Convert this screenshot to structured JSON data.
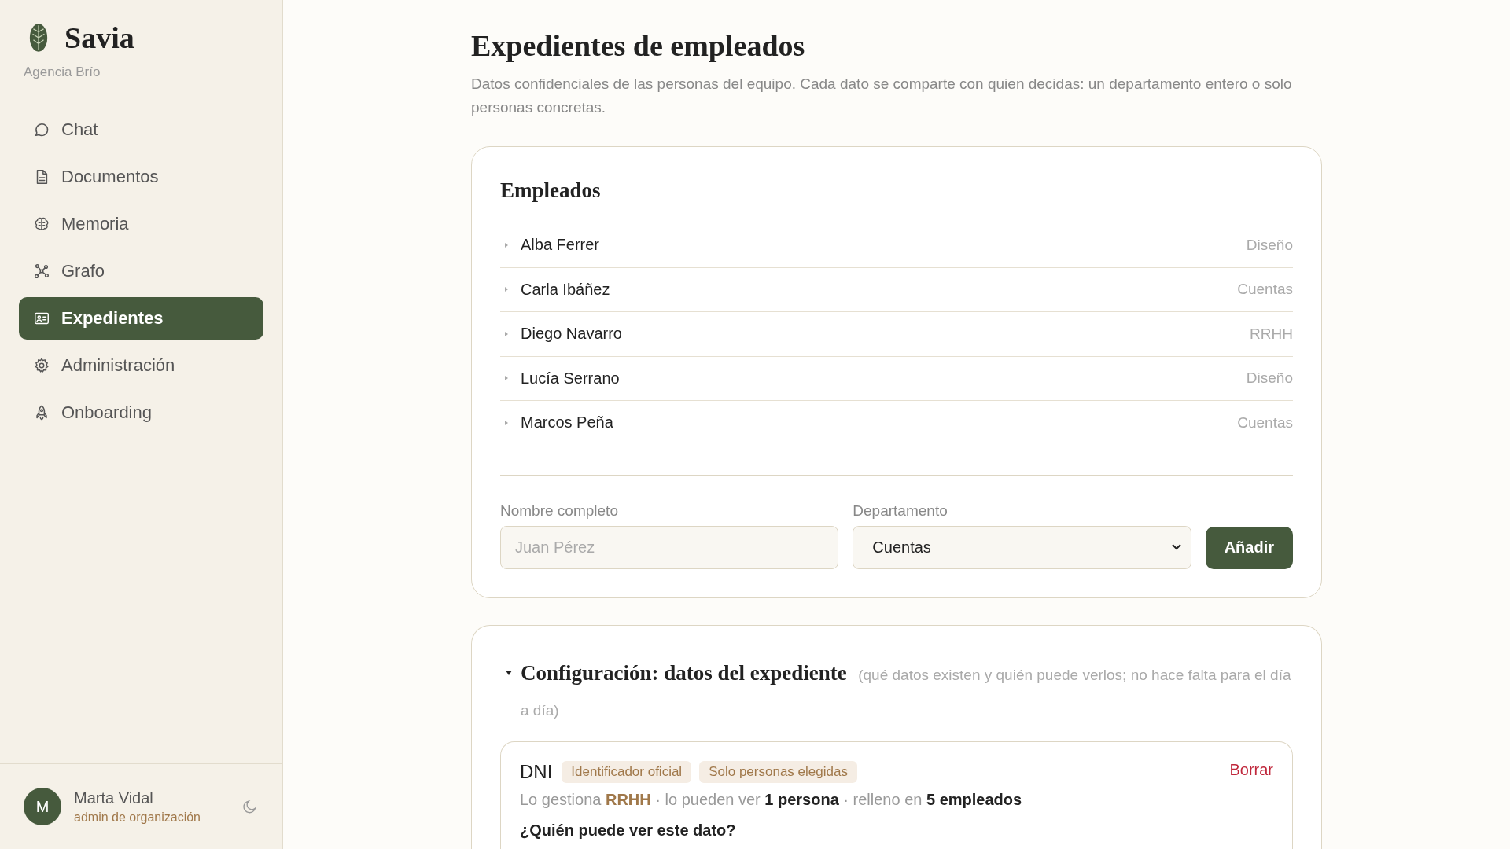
{
  "sidebar": {
    "brand": "Savia",
    "organization": "Agencia Brío",
    "nav": [
      {
        "label": "Chat",
        "kind": "chat",
        "selected": false
      },
      {
        "label": "Documentos",
        "kind": "document",
        "selected": false
      },
      {
        "label": "Memoria",
        "kind": "brain",
        "selected": false
      },
      {
        "label": "Grafo",
        "kind": "graph",
        "selected": false
      },
      {
        "label": "Expedientes",
        "kind": "card",
        "selected": true
      },
      {
        "label": "Administración",
        "kind": "gear",
        "selected": false
      },
      {
        "label": "Onboarding",
        "kind": "rocket",
        "selected": false
      }
    ],
    "user": {
      "initial": "M",
      "name": "Marta Vidal",
      "role": "admin de organización"
    }
  },
  "page": {
    "title": "Expedientes de empleados",
    "subtitle": "Datos confidenciales de las personas del equipo. Cada dato se comparte con quien decidas: un departamento entero o solo personas concretas."
  },
  "employees_card": {
    "title": "Empleados",
    "employees": [
      {
        "name": "Alba Ferrer",
        "department": "Diseño",
        "expanded": false
      },
      {
        "name": "Carla Ibáñez",
        "department": "Cuentas",
        "expanded": false
      },
      {
        "name": "Diego Navarro",
        "department": "RRHH",
        "expanded": false
      },
      {
        "name": "Lucía Serrano",
        "department": "Diseño",
        "expanded": false
      },
      {
        "name": "Marcos Peña",
        "department": "Cuentas",
        "expanded": false
      }
    ],
    "form": {
      "fields": [
        {
          "kind": "text",
          "label": "Nombre completo",
          "placeholder": "Juan Pérez"
        },
        {
          "kind": "select",
          "label": "Departamento",
          "value": "Cuentas"
        }
      ],
      "submit": "Añadir"
    }
  },
  "config": {
    "title": "Configuración: datos del expediente",
    "hint": "(qué datos existen y quién puede verlos; no hace falta para el día a día)",
    "expanded": true,
    "fields": [
      {
        "name": "DNI",
        "tags": [
          "Identificador oficial",
          "Solo personas elegidas"
        ],
        "delete": "Borrar",
        "meta": [
          {
            "text": "Lo gestiona ",
            "kind": "plain"
          },
          {
            "text": "RRHH",
            "kind": "accent"
          },
          {
            "text": " · lo pueden ver ",
            "kind": "plain"
          },
          {
            "text": "1 persona",
            "kind": "strong"
          },
          {
            "text": " · relleno en ",
            "kind": "plain"
          },
          {
            "text": "5 empleados",
            "kind": "strong"
          }
        ],
        "question": "¿Quién puede ver este dato?"
      }
    ]
  }
}
